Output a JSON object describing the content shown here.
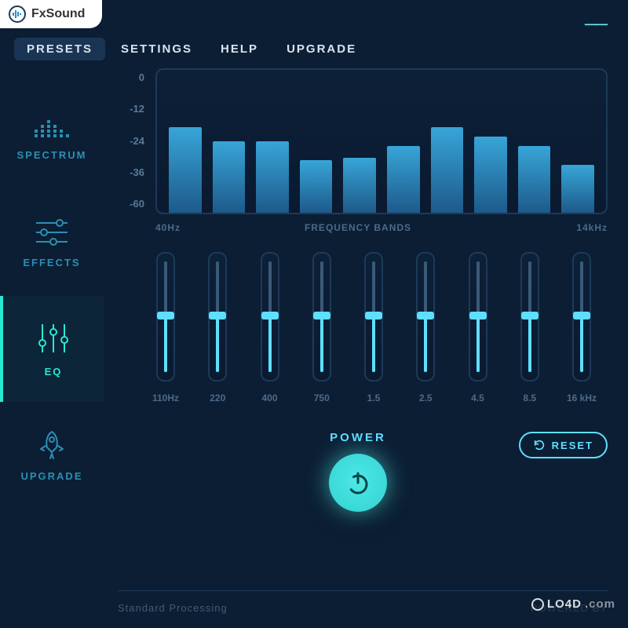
{
  "app": {
    "name": "FxSound"
  },
  "menu": {
    "items": [
      "PRESETS",
      "SETTINGS",
      "HELP",
      "UPGRADE"
    ],
    "active_index": 0
  },
  "sidebar": {
    "items": [
      {
        "label": "SPECTRUM",
        "icon": "spectrum-icon"
      },
      {
        "label": "EFFECTS",
        "icon": "sliders-h-icon"
      },
      {
        "label": "EQ",
        "icon": "eq-icon"
      },
      {
        "label": "UPGRADE",
        "icon": "rocket-icon"
      }
    ],
    "active_index": 2
  },
  "chart_data": {
    "type": "bar",
    "title": "FREQUENCY BANDS",
    "xlabel_left": "40Hz",
    "xlabel_right": "14kHz",
    "y_ticks": [
      "0",
      "-12",
      "-24",
      "-36",
      "-60"
    ],
    "ylim": [
      -60,
      0
    ],
    "categories": [
      "40Hz",
      "110",
      "220",
      "400",
      "750",
      "1.5k",
      "2.5k",
      "4.5k",
      "8.5k",
      "14kHz"
    ],
    "values": [
      -24,
      -30,
      -30,
      -38,
      -37,
      -32,
      -24,
      -28,
      -32,
      -40
    ]
  },
  "sliders": {
    "range": [
      0,
      100
    ],
    "bands": [
      {
        "label": "110Hz",
        "value": 50
      },
      {
        "label": "220",
        "value": 50
      },
      {
        "label": "400",
        "value": 50
      },
      {
        "label": "750",
        "value": 50
      },
      {
        "label": "1.5",
        "value": 50
      },
      {
        "label": "2.5",
        "value": 50
      },
      {
        "label": "4.5",
        "value": 50
      },
      {
        "label": "8.5",
        "value": 50
      },
      {
        "label": "16 kHz",
        "value": 50
      }
    ]
  },
  "controls": {
    "power_label": "POWER",
    "reset_label": "RESET",
    "power_on": true
  },
  "footer": {
    "left": "Standard Processing",
    "right": "POWERED BY"
  },
  "watermark": "LO4D",
  "colors": {
    "accent": "#5fdfff",
    "accent2": "#28e8d4",
    "bg": "#0c1e34"
  }
}
